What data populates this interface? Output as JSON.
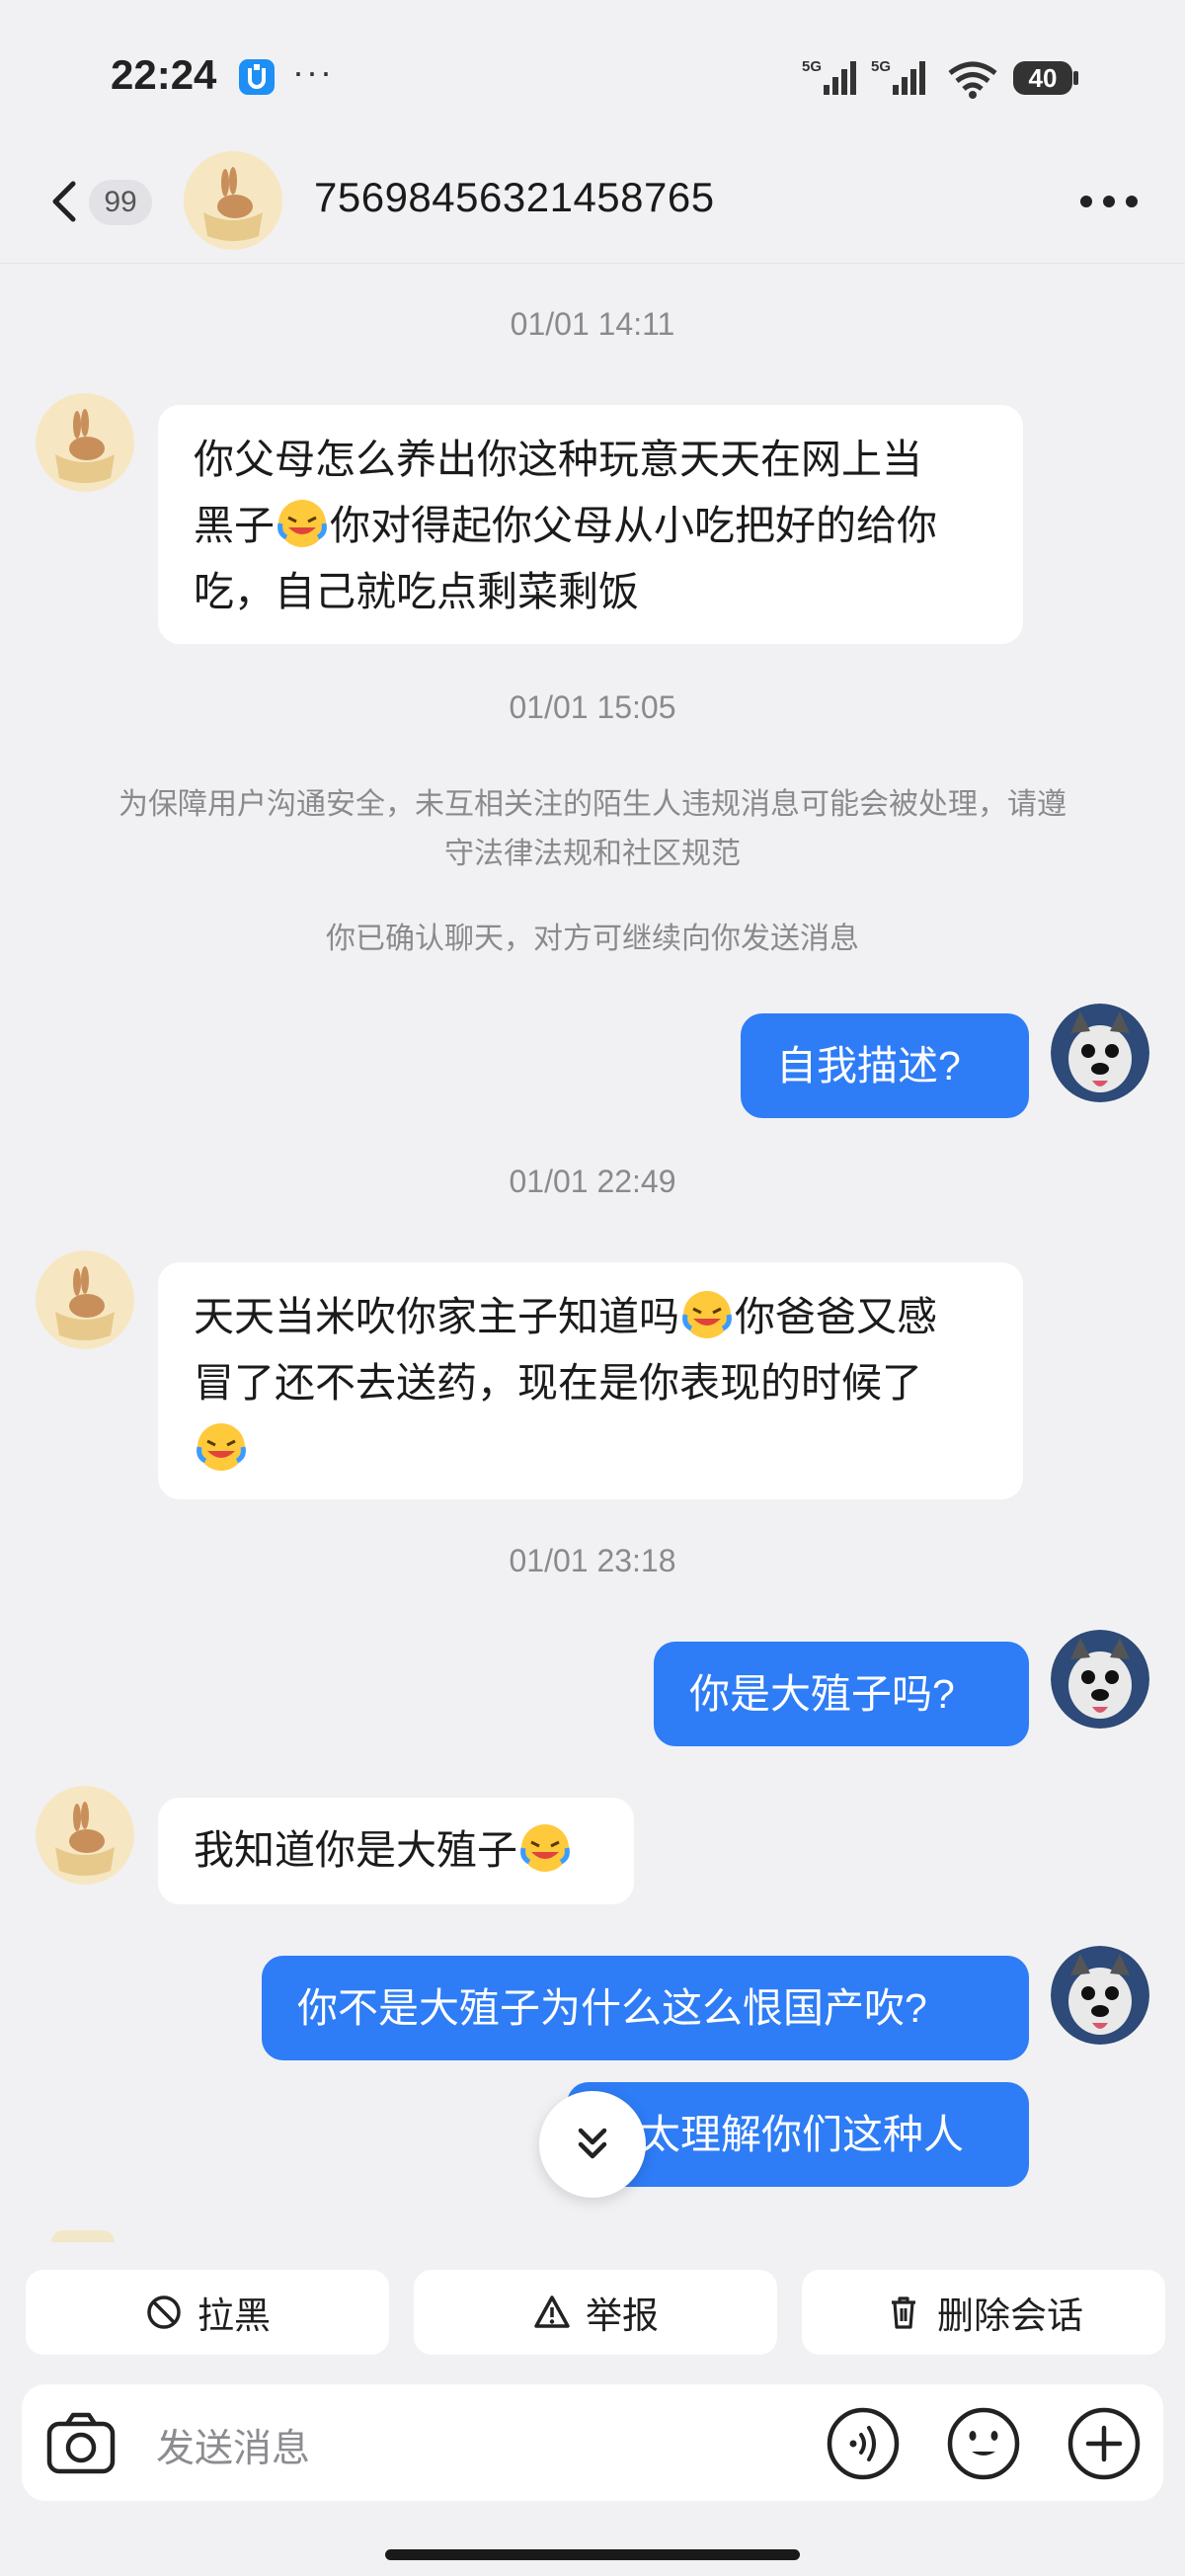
{
  "status_bar": {
    "time": "22:24",
    "extra": "···",
    "network1": "5G",
    "network2": "5G",
    "battery": "40"
  },
  "header": {
    "unread_count": "99",
    "title": "7569845632145​8765"
  },
  "messages": {
    "ts1": "01/01 14:11",
    "m1_a": "你父母怎么养出你这种玩意天天在网上当",
    "m1_b": "黑子",
    "m1_c": "你对得起你父母从小吃把好的给你",
    "m1_d": "吃，自己就吃点剩菜剩饭",
    "ts2": "01/01 15:05",
    "notice1": "为保障用户沟通安全，未互相关注的陌生人违规消息可能会被处理，请遵守法律法规和社区规范",
    "notice2": "你已确认聊天，对方可继续向你发送消息",
    "o1": "自我描述?",
    "ts3": "01/01 22:49",
    "m2_a": "天天当米吹你家主子知道吗",
    "m2_b": "你爸爸又感",
    "m2_c": "冒了还不去送药，现在是你表现的时候了",
    "ts4": "01/01 23:18",
    "o2": "你是大殖子吗?",
    "m3": "我知道你是大殖子",
    "o3": "你不是大殖子为什么这么恨国产吹?",
    "o4": "太理解你们这种人"
  },
  "actions": {
    "block": "拉黑",
    "report": "举报",
    "delete": "删除会话"
  },
  "input": {
    "placeholder": "发送消息"
  },
  "colors": {
    "outgoing_bubble": "#2e7cf6",
    "incoming_bubble": "#ffffff",
    "background": "#f1f1f3"
  }
}
